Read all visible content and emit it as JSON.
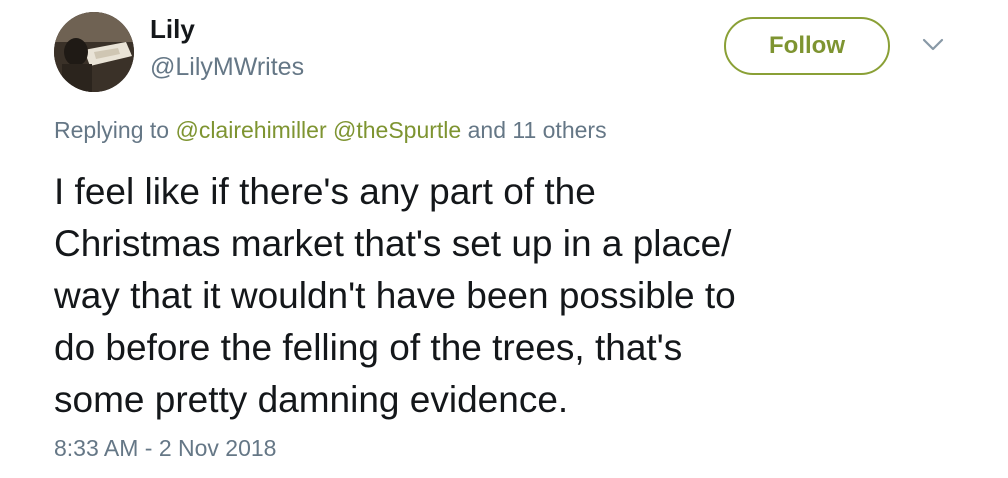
{
  "author": {
    "display_name": "Lily",
    "handle": "@LilyMWrites"
  },
  "follow_button": {
    "label": "Follow"
  },
  "more_menu": {
    "icon": "chevron-down-icon"
  },
  "reply": {
    "prefix": "Replying to ",
    "mentions": [
      "@clairehimiller",
      "@theSpurtle"
    ],
    "suffix": " and 11 others"
  },
  "tweet": {
    "lines": [
      "I feel like if there's any part of the",
      "Christmas market that's set up in a place/",
      "way that it wouldn't have been possible to",
      "do before the felling of the trees, that's",
      "some pretty damning evidence."
    ],
    "timestamp": "8:33 AM - 2 Nov 2018"
  },
  "colors": {
    "accent": "#7e9431",
    "secondary_text": "#657786",
    "primary_text": "#14171a"
  }
}
